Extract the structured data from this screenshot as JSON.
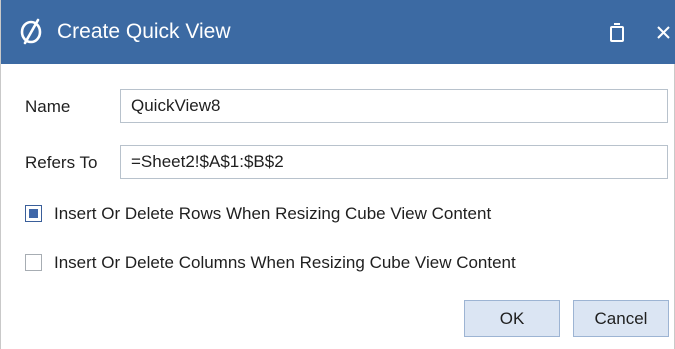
{
  "dialog": {
    "title": "Create Quick View",
    "colors": {
      "titlebar": "#3c6aa3",
      "button_bg": "#dbe5f3",
      "checkbox_fill": "#3f67a8"
    }
  },
  "form": {
    "name_label": "Name",
    "name_value": "QuickView8",
    "refers_to_label": "Refers To",
    "refers_to_value": "=Sheet2!$A$1:$B$2"
  },
  "options": [
    {
      "label": "Insert Or Delete Rows When Resizing Cube View Content",
      "checked": true
    },
    {
      "label": "Insert Or Delete Columns When Resizing Cube View Content",
      "checked": false
    }
  ],
  "buttons": {
    "ok_label": "OK",
    "cancel_label": "Cancel"
  },
  "icons": {
    "app": "app-logo-icon",
    "restore": "restore-window-icon",
    "close": "close-icon"
  }
}
